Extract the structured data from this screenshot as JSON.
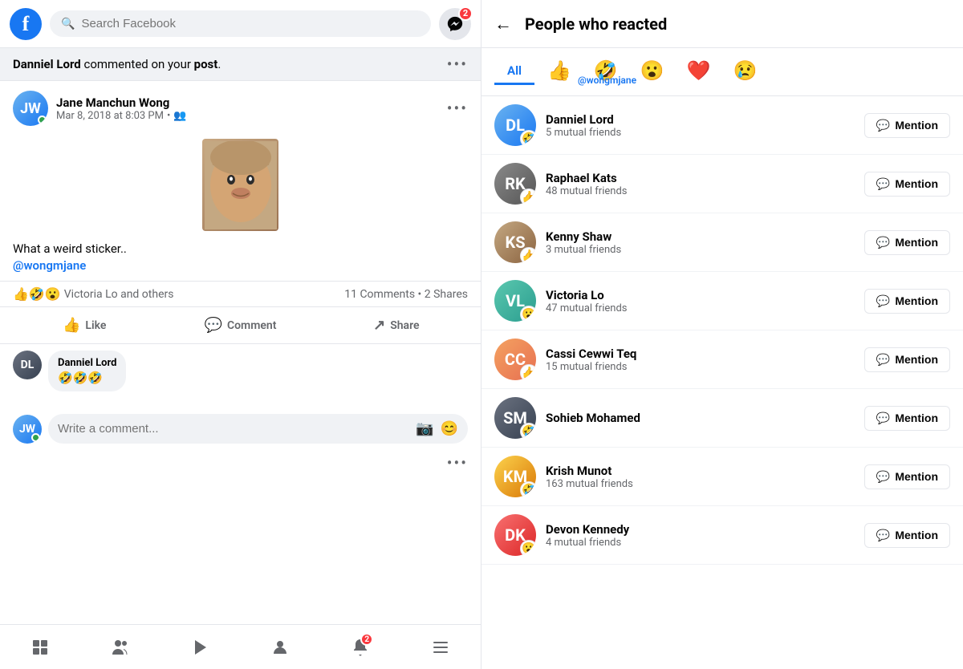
{
  "left": {
    "search_placeholder": "Search Facebook",
    "messenger_badge": "2",
    "notification": {
      "text_prefix": "Danniel Lord",
      "text_middle": " commented on your ",
      "text_bold": "post",
      "text_suffix": ".",
      "more_icon": "•••"
    },
    "post": {
      "author": "Jane Manchun Wong",
      "time": "Mar 8, 2018 at 8:03 PM",
      "text": "What a weird sticker..",
      "mention": "@wongmjane",
      "reactions_label": "Victoria Lo and others",
      "comments_count": "11 Comments",
      "shares_count": "2 Shares",
      "like_label": "Like",
      "comment_label": "Comment",
      "share_label": "Share"
    },
    "comment": {
      "author": "Danniel Lord",
      "text": "🤣🤣🤣"
    },
    "comment_input_placeholder": "Write a comment...",
    "bottom_nav": {
      "notification_badge": "2",
      "more_icon": "•••"
    }
  },
  "right": {
    "back_icon": "←",
    "title": "People who reacted",
    "tabs": [
      {
        "label": "All",
        "emoji": "",
        "active": true
      },
      {
        "label": "",
        "emoji": "👍",
        "active": false
      },
      {
        "label": "",
        "emoji": "🤣",
        "active": false
      },
      {
        "label": "",
        "emoji": "😮",
        "active": false
      },
      {
        "label": "",
        "emoji": "❤️",
        "active": false
      },
      {
        "label": "",
        "emoji": "😢",
        "active": false
      }
    ],
    "mention_label": "@wongmjane",
    "people": [
      {
        "name": "Danniel Lord",
        "mutual": "5 mutual friends",
        "reaction": "🤣",
        "av_class": "av-blue",
        "initials": "DL",
        "mention_label": "Mention"
      },
      {
        "name": "Raphael Kats",
        "mutual": "48 mutual friends",
        "reaction": "👍",
        "av_class": "av-gray",
        "initials": "RK",
        "mention_label": "Mention"
      },
      {
        "name": "Kenny Shaw",
        "mutual": "3 mutual friends",
        "reaction": "👍",
        "av_class": "av-brown",
        "initials": "KS",
        "mention_label": "Mention"
      },
      {
        "name": "Victoria Lo",
        "mutual": "47 mutual friends",
        "reaction": "😮",
        "av_class": "av-teal",
        "initials": "VL",
        "mention_label": "Mention"
      },
      {
        "name": "Cassi Cewwi Teq",
        "mutual": "15 mutual friends",
        "reaction": "👍",
        "av_class": "av-orange",
        "initials": "CC",
        "mention_label": "Mention"
      },
      {
        "name": "Sohieb Mohamed",
        "mutual": "",
        "reaction": "🤣",
        "av_class": "av-dark",
        "initials": "SM",
        "mention_label": "Mention"
      },
      {
        "name": "Krish Munot",
        "mutual": "163 mutual friends",
        "reaction": "🤣",
        "av_class": "av-golden",
        "initials": "KM",
        "mention_label": "Mention"
      },
      {
        "name": "Devon Kennedy",
        "mutual": "4 mutual friends",
        "reaction": "😮",
        "av_class": "av-red",
        "initials": "DK",
        "mention_label": "Mention"
      }
    ]
  }
}
